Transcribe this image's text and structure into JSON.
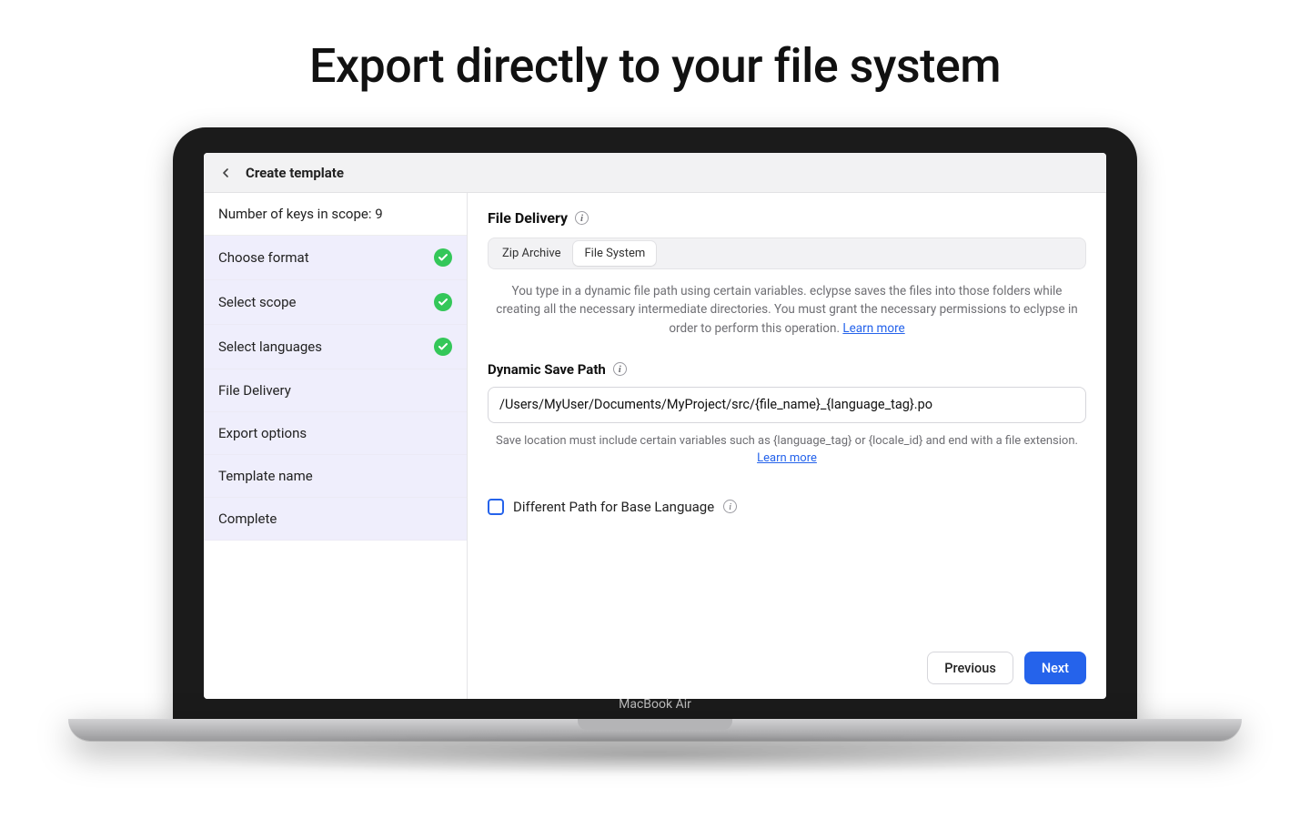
{
  "hero": {
    "title": "Export directly to your file system"
  },
  "device": {
    "model": "MacBook Air"
  },
  "header": {
    "back_aria": "Back",
    "title": "Create template"
  },
  "sidebar": {
    "keys_scope_label": "Number of keys in scope: 9",
    "steps": [
      {
        "label": "Choose format",
        "done": true
      },
      {
        "label": "Select scope",
        "done": true
      },
      {
        "label": "Select languages",
        "done": true
      },
      {
        "label": "File Delivery",
        "done": false
      },
      {
        "label": "Export options",
        "done": false
      },
      {
        "label": "Template name",
        "done": false
      },
      {
        "label": "Complete",
        "done": false
      }
    ]
  },
  "main": {
    "file_delivery_title": "File Delivery",
    "segments": {
      "zip": "Zip Archive",
      "fs": "File System",
      "active": "fs"
    },
    "description": "You type in a dynamic file path using certain variables. eclypse saves the files into those folders while creating all the necessary intermediate directories. You must grant the necessary permissions to eclypse in order to perform this operation. ",
    "learn_more": "Learn more",
    "dynamic_path_label": "Dynamic Save Path",
    "dynamic_path_value": "/Users/MyUser/Documents/MyProject/src/{file_name}_{language_tag}.po",
    "dynamic_path_hint": "Save location must include certain variables such as {language_tag} or {locale_id} and end with a file extension. ",
    "diff_path_label": "Different Path for Base Language",
    "footer": {
      "previous": "Previous",
      "next": "Next"
    }
  }
}
